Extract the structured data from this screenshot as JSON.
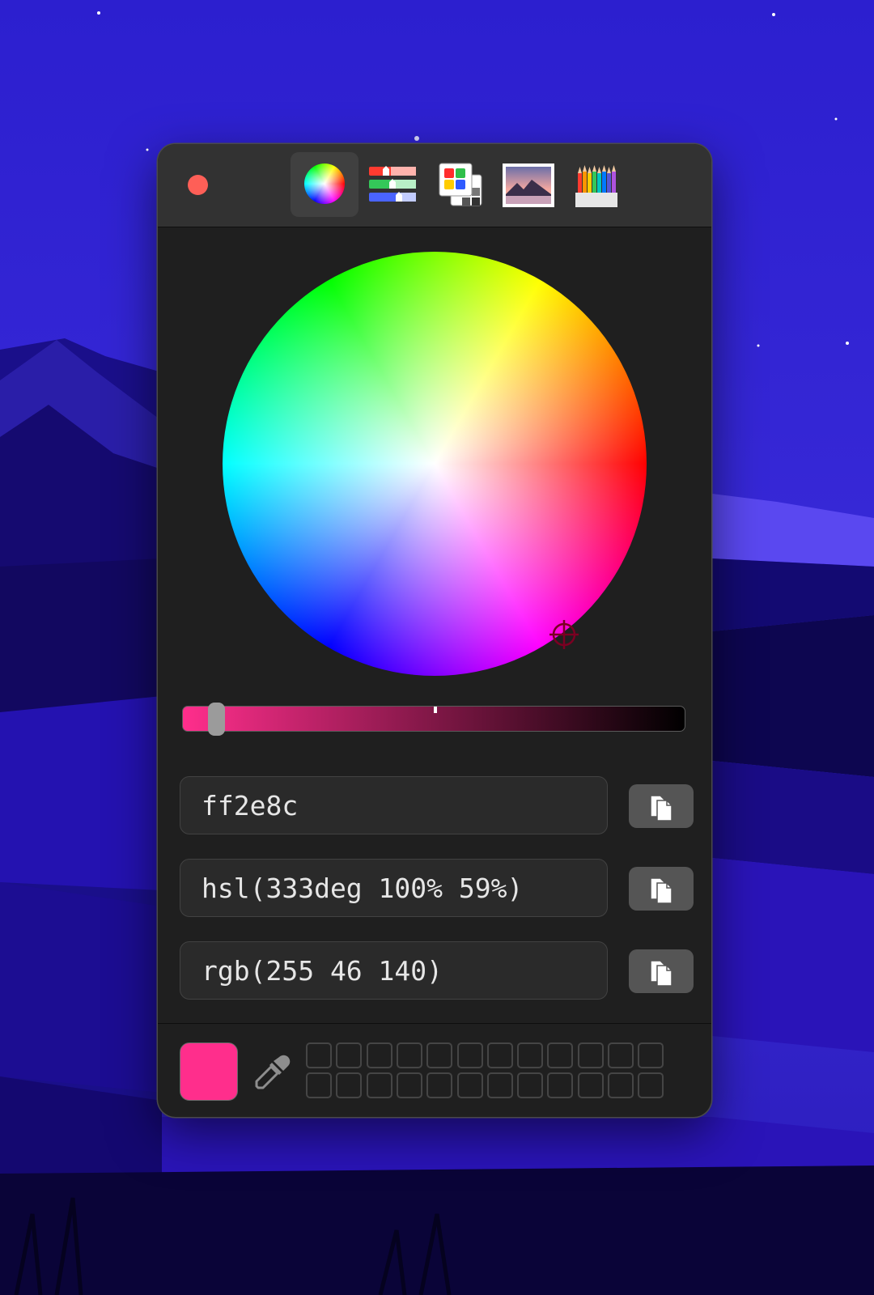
{
  "window": {
    "toolbar": {
      "tabs": [
        {
          "name": "Color Wheel",
          "icon": "color-wheel-icon",
          "selected": true
        },
        {
          "name": "Color Sliders",
          "icon": "sliders-icon",
          "selected": false
        },
        {
          "name": "Color Palettes",
          "icon": "palettes-icon",
          "selected": false
        },
        {
          "name": "Image Palettes",
          "icon": "image-icon",
          "selected": false
        },
        {
          "name": "Pencils",
          "icon": "pencils-icon",
          "selected": false
        }
      ]
    },
    "wheel": {
      "selected_hue_deg": 333,
      "selected_saturation_pct": 100
    },
    "brightness_slider": {
      "value_fraction": 0.96,
      "gradient_start": "#ff2e8c",
      "gradient_end": "#000000"
    },
    "values": {
      "hex": "ff2e8c",
      "hsl": "hsl(333deg 100% 59%)",
      "rgb": "rgb(255 46 140)"
    },
    "current_color": "#ff2e8c",
    "swatch_slots": {
      "rows": 2,
      "columns": 12
    }
  },
  "colors": {
    "accent": "#ff2e8c",
    "close_button": "#fe5f57",
    "panel_bg": "#1f1f1f",
    "titlebar_bg": "#323232",
    "field_bg": "#2a2a2a",
    "copy_button_bg": "#555555"
  }
}
